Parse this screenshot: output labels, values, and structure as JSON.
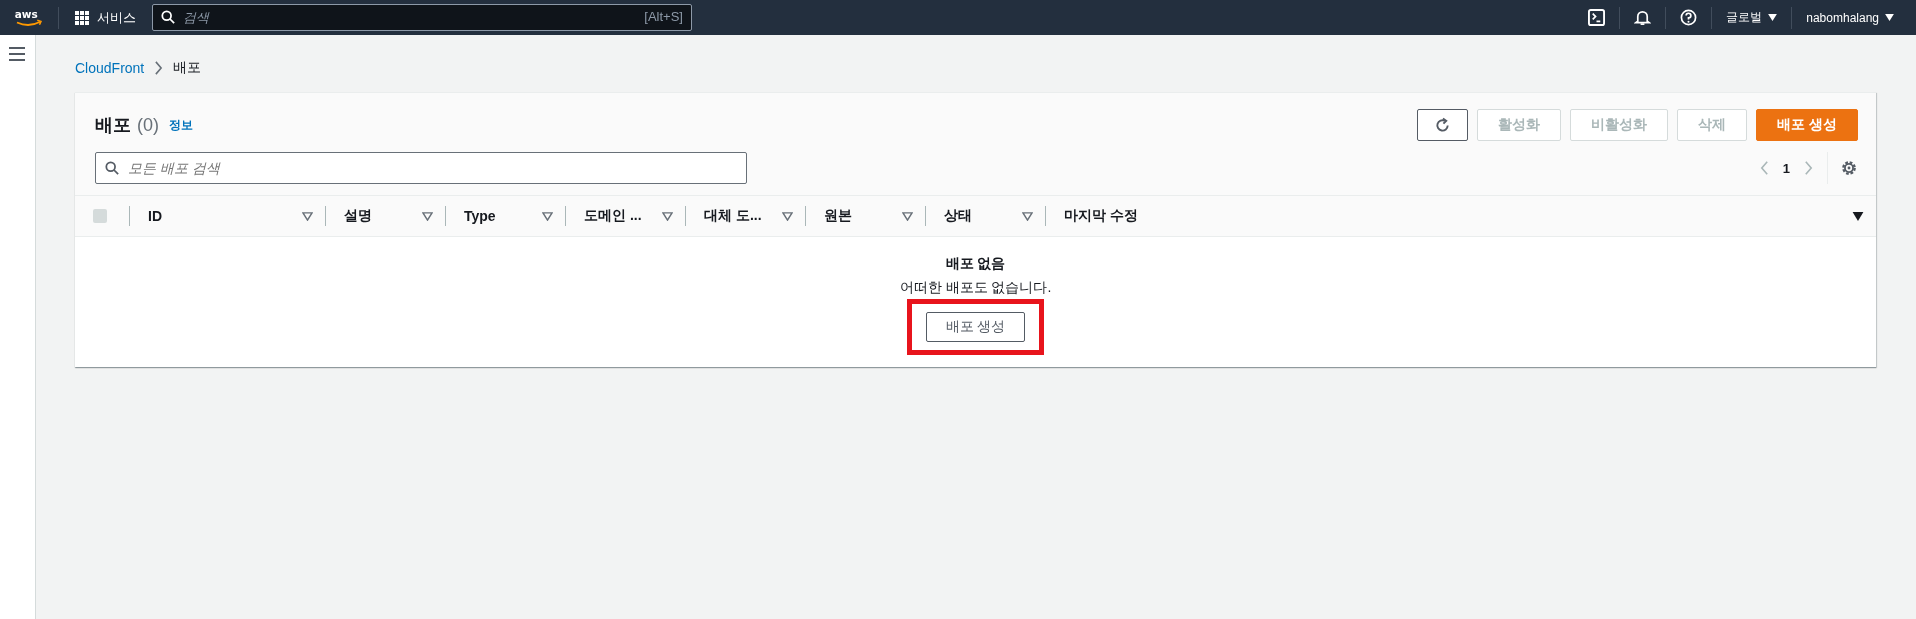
{
  "topbar": {
    "logo": "aws",
    "services": "서비스",
    "search": {
      "placeholder": "검색",
      "shortcut": "[Alt+S]"
    },
    "region": "글로벌",
    "user": "nabomhalang"
  },
  "breadcrumb": [
    "CloudFront",
    "배포"
  ],
  "panel": {
    "title": "배포",
    "count": "(0)",
    "info_link": "정보",
    "buttons": [
      {
        "kind": "refresh",
        "disabled": false
      },
      {
        "kind": "normal",
        "label": "활성화",
        "disabled": true
      },
      {
        "kind": "normal",
        "label": "비활성화",
        "disabled": true
      },
      {
        "kind": "normal",
        "label": "삭제",
        "disabled": true
      },
      {
        "kind": "primary",
        "label": "배포 생성",
        "disabled": false
      }
    ],
    "filter": {
      "placeholder": "모든 배포 검색"
    },
    "pagination": {
      "page": "1",
      "prev_disabled": true,
      "next_disabled": true
    },
    "select_all": {
      "checked": false,
      "disabled": true
    },
    "columns": [
      {
        "label": "ID",
        "sorted": false
      },
      {
        "label": "설명",
        "sorted": false
      },
      {
        "label": "Type",
        "sorted": false
      },
      {
        "label": "도메인 ...",
        "sorted": false
      },
      {
        "label": "대체 도...",
        "sorted": false
      },
      {
        "label": "원본",
        "sorted": false
      },
      {
        "label": "상태",
        "sorted": false
      },
      {
        "label": "마지막 수정",
        "sorted": true
      }
    ],
    "empty_state": {
      "title": "배포 없음",
      "message": "어떠한 배포도 없습니다.",
      "button": {
        "label": "배포 생성",
        "highlighted": true
      }
    }
  }
}
